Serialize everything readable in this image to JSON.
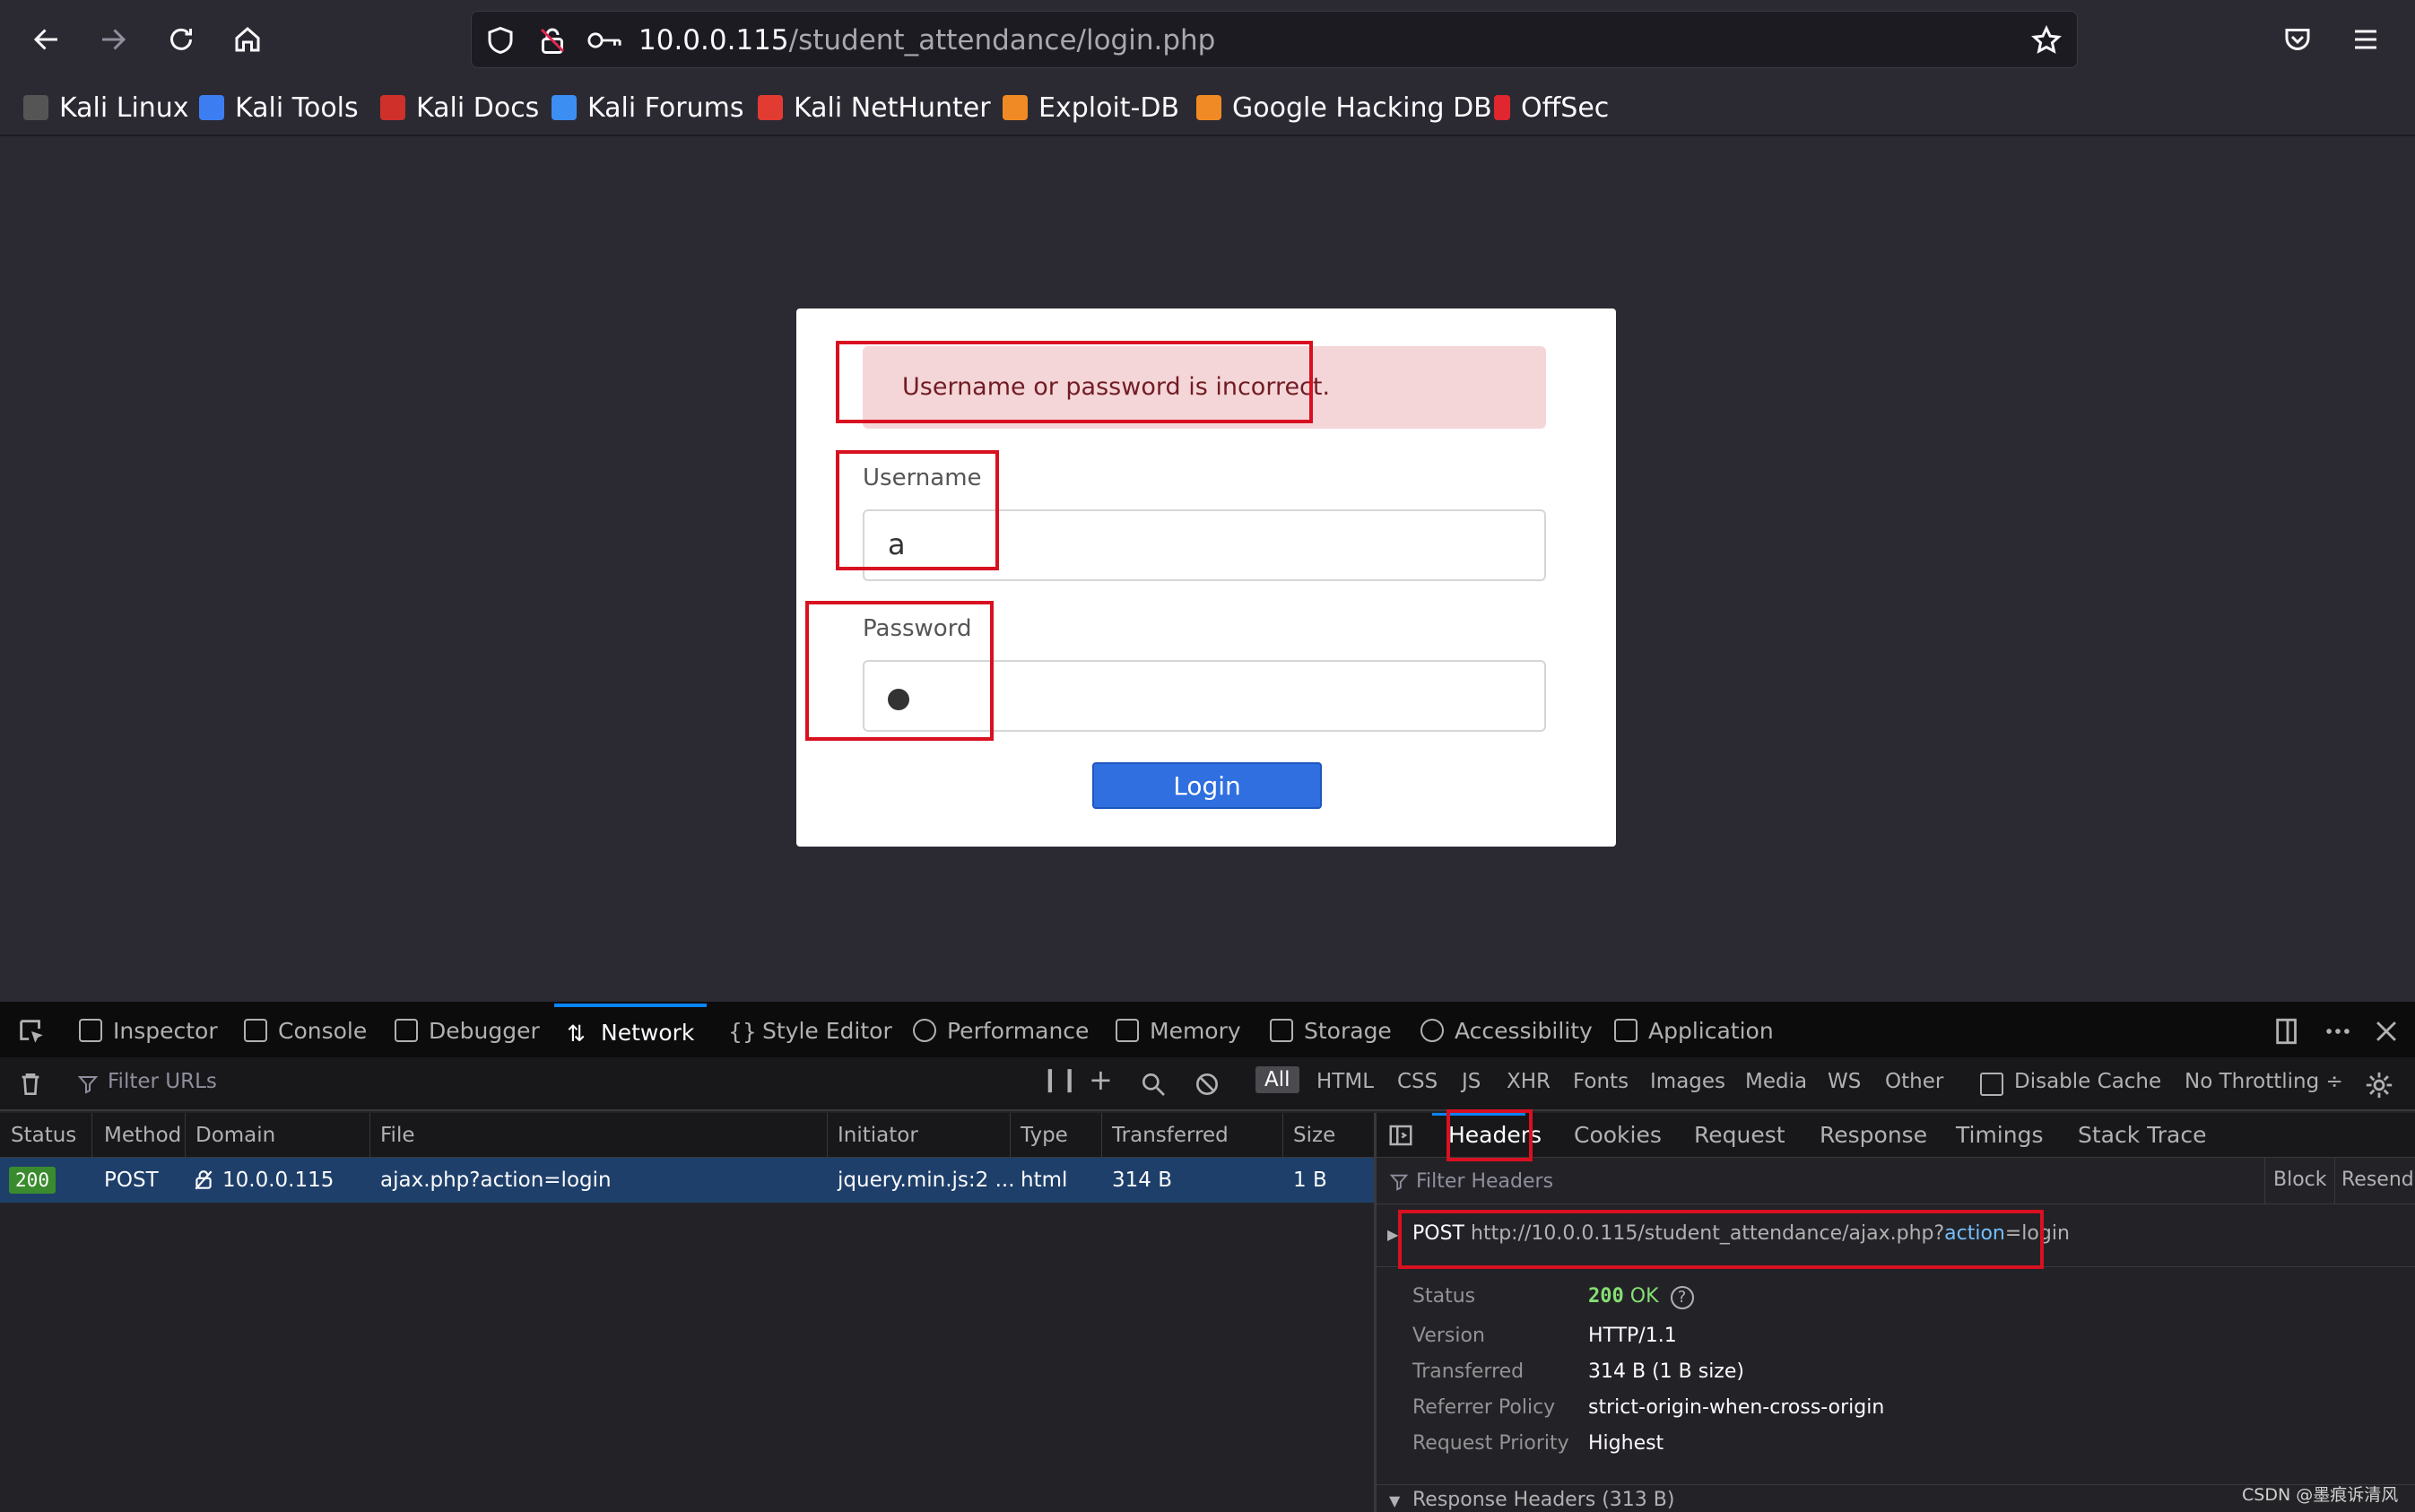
{
  "browser": {
    "url_host": "10.0.0.115",
    "url_path": "/student_attendance/login.php"
  },
  "bookmarks": [
    {
      "label": "Kali Linux",
      "icon": "kali-dragon-icon",
      "color": "#dddddd"
    },
    {
      "label": "Kali Tools",
      "icon": "kali-tools-icon",
      "color": "#3d7df2"
    },
    {
      "label": "Kali Docs",
      "icon": "kali-docs-icon",
      "color": "#d0302a"
    },
    {
      "label": "Kali Forums",
      "icon": "kali-forums-icon",
      "color": "#3d8ef2"
    },
    {
      "label": "Kali NetHunter",
      "icon": "nethunter-icon",
      "color": "#e23b32"
    },
    {
      "label": "Exploit-DB",
      "icon": "exploit-db-icon",
      "color": "#f08a24"
    },
    {
      "label": "Google Hacking DB",
      "icon": "ghdb-icon",
      "color": "#f08a24"
    },
    {
      "label": "OffSec",
      "icon": "offsec-icon",
      "color": "#e0262e"
    }
  ],
  "login_form": {
    "error_message": "Username or password is incorrect.",
    "username_label": "Username",
    "username_value": "a",
    "password_label": "Password",
    "login_button": "Login"
  },
  "devtools": {
    "tabs": [
      "Inspector",
      "Console",
      "Debugger",
      "Network",
      "Style Editor",
      "Performance",
      "Memory",
      "Storage",
      "Accessibility",
      "Application"
    ],
    "active_tab": "Network",
    "filter_placeholder": "Filter URLs",
    "type_filters": [
      "All",
      "HTML",
      "CSS",
      "JS",
      "XHR",
      "Fonts",
      "Images",
      "Media",
      "WS",
      "Other"
    ],
    "disable_cache": "Disable Cache",
    "throttling": "No Throttling ÷",
    "columns": [
      "Status",
      "Method",
      "Domain",
      "File",
      "Initiator",
      "Type",
      "Transferred",
      "Size"
    ],
    "request": {
      "status": "200",
      "method": "POST",
      "domain": "10.0.0.115",
      "file": "ajax.php?action=login",
      "initiator": "jquery.min.js:2 ...",
      "type": "html",
      "transferred": "314 B",
      "size": "1 B"
    },
    "panel_tabs": [
      "Headers",
      "Cookies",
      "Request",
      "Response",
      "Timings",
      "Stack Trace"
    ],
    "filter_headers": "Filter Headers",
    "block": "Block",
    "resend": "Resend",
    "request_line": {
      "method": "POST",
      "url_prefix": "http://10.0.0.115/student_attendance/ajax.php?",
      "url_param": "action",
      "url_suffix": "=login"
    },
    "headers": [
      {
        "key": "Status",
        "value": ""
      },
      {
        "key": "Version",
        "value": "HTTP/1.1"
      },
      {
        "key": "Transferred",
        "value": "314 B (1 B size)"
      },
      {
        "key": "Referrer Policy",
        "value": "strict-origin-when-cross-origin"
      },
      {
        "key": "Request Priority",
        "value": "Highest"
      }
    ],
    "status_code": "200",
    "status_text": "OK",
    "response_headers": "Response Headers (313 B)"
  },
  "watermark": "CSDN @墨痕诉清风"
}
